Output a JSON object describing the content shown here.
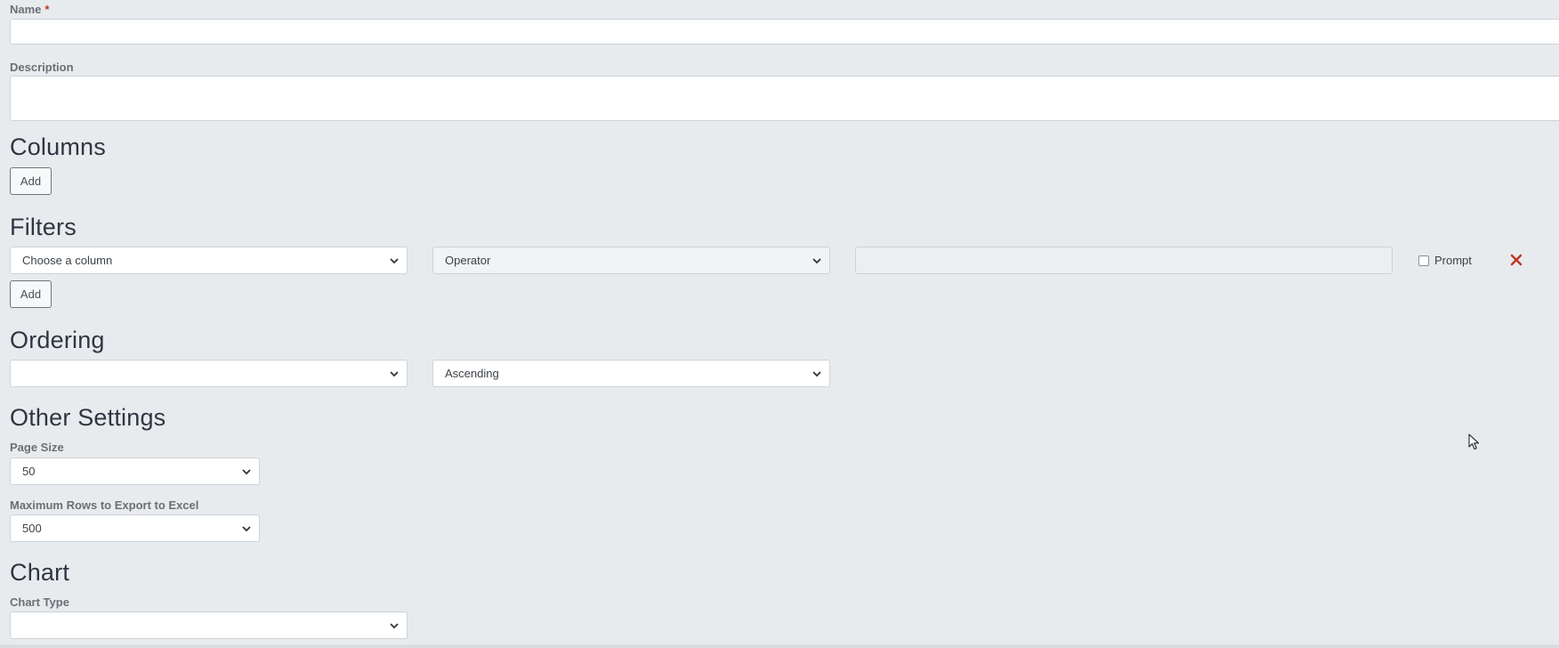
{
  "name_field": {
    "label": "Name",
    "required_mark": "*",
    "value": ""
  },
  "description_field": {
    "label": "Description",
    "value": ""
  },
  "columns": {
    "title": "Columns",
    "add_label": "Add"
  },
  "filters": {
    "title": "Filters",
    "column_select": "Choose a column",
    "operator_select": "Operator",
    "value": "",
    "prompt_label": "Prompt",
    "prompt_checked": false,
    "remove_icon": "close-icon",
    "add_label": "Add"
  },
  "ordering": {
    "title": "Ordering",
    "column_select": "",
    "direction_select": "Ascending"
  },
  "other_settings": {
    "title": "Other Settings",
    "page_size_label": "Page Size",
    "page_size_value": "50",
    "max_rows_label": "Maximum Rows to Export to Excel",
    "max_rows_value": "500"
  },
  "chart": {
    "title": "Chart",
    "chart_type_label": "Chart Type",
    "chart_type_value": ""
  },
  "colors": {
    "background": "#e8ebee",
    "required": "#c0392b",
    "remove": "#c0392b"
  }
}
